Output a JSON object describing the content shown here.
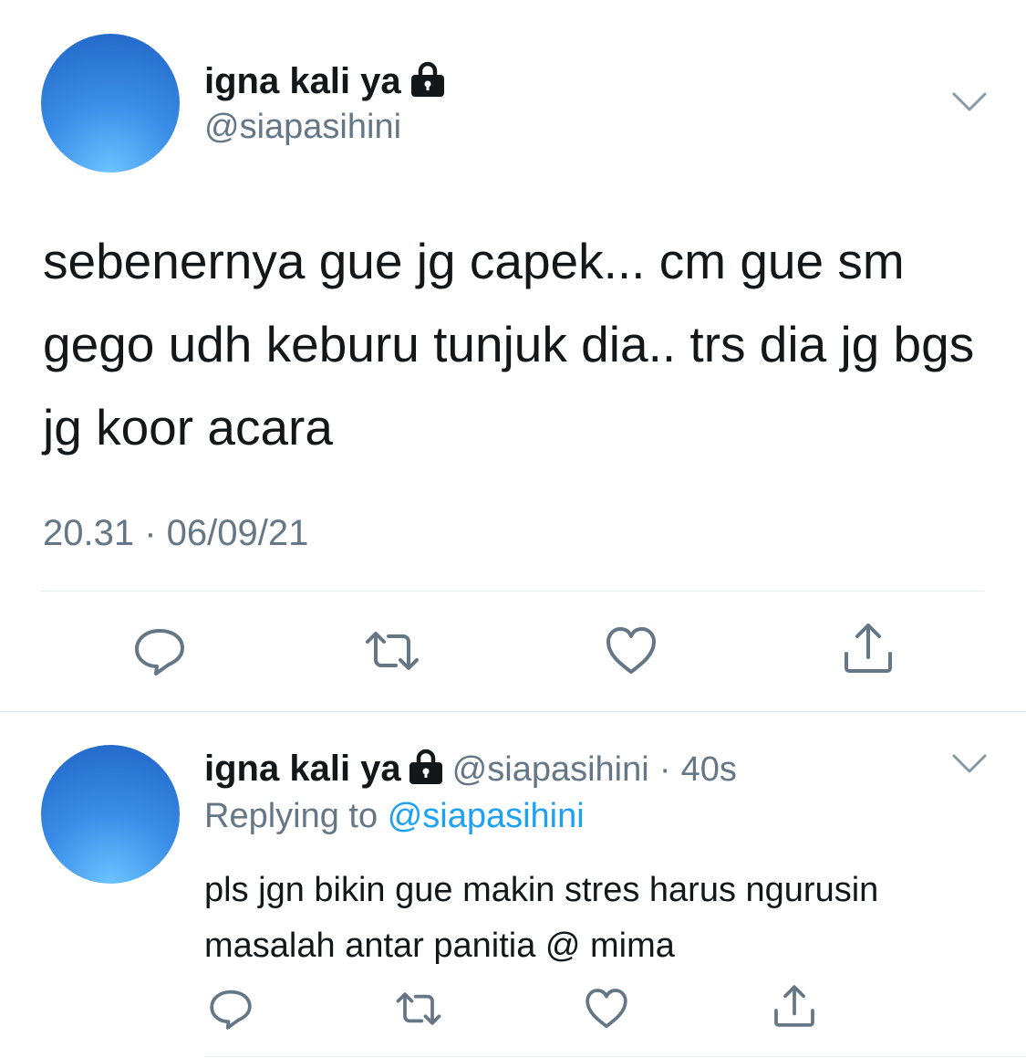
{
  "colors": {
    "text_primary": "#14171a",
    "text_secondary": "#657786",
    "link": "#1da1f2",
    "icon": "#657786",
    "divider": "#e1e8ed"
  },
  "main_tweet": {
    "display_name": "igna kali ya",
    "handle": "@siapasihini",
    "text": "sebenernya gue jg capek... cm gue sm gego udh keburu tunjuk dia.. trs dia jg bgs jg koor acara",
    "timestamp": "20.31 · 06/09/21",
    "icons": [
      "lock-icon",
      "chevron-down-icon",
      "reply-icon",
      "retweet-icon",
      "like-icon",
      "share-icon"
    ]
  },
  "reply_tweet": {
    "display_name": "igna kali ya",
    "handle": "@siapasihini",
    "separator": "·",
    "time_ago": "40s",
    "replying_prefix": "Replying to",
    "replying_to": "@siapasihini",
    "text": "pls jgn bikin gue makin stres harus ngurusin masalah antar panitia @ mima",
    "icons": [
      "lock-icon",
      "chevron-down-icon",
      "reply-icon",
      "retweet-icon",
      "like-icon",
      "share-icon"
    ]
  }
}
